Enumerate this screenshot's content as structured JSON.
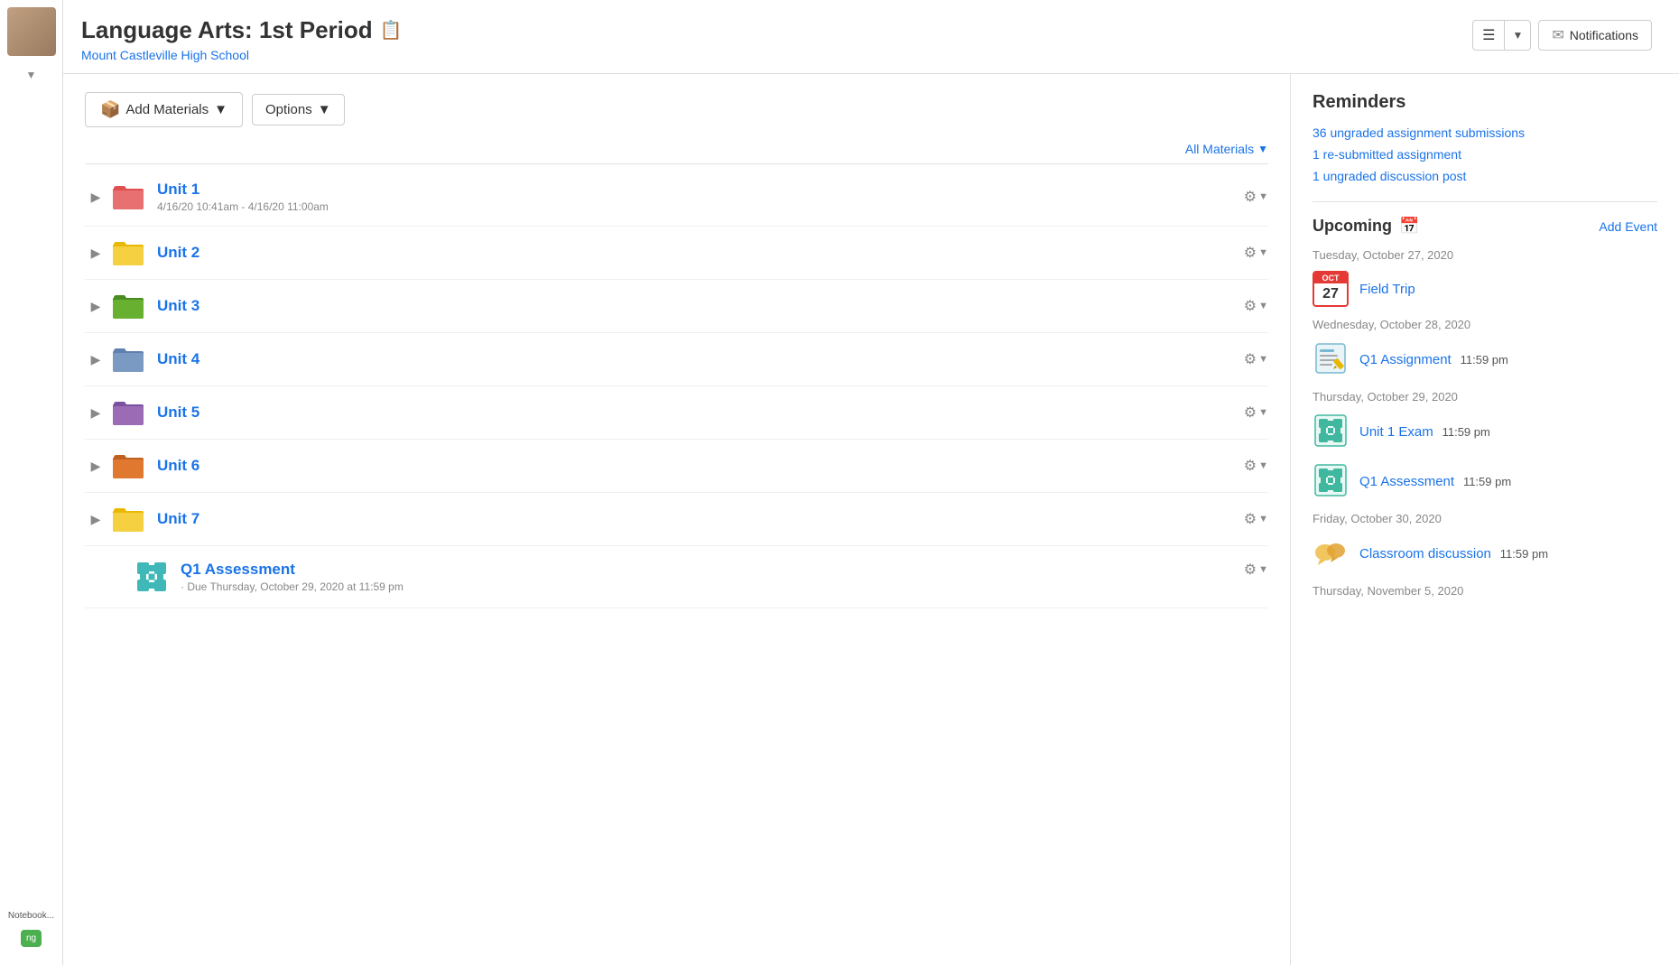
{
  "header": {
    "title": "Language Arts: 1st Period",
    "title_icon": "📋",
    "subtitle": "Mount Castleville High School",
    "notifications_label": "Notifications"
  },
  "toolbar": {
    "add_materials_label": "Add Materials",
    "options_label": "Options"
  },
  "filter": {
    "label": "All Materials"
  },
  "units": [
    {
      "id": 1,
      "name": "Unit 1",
      "color": "red",
      "date": "4/16/20 10:41am - 4/16/20 11:00am"
    },
    {
      "id": 2,
      "name": "Unit 2",
      "color": "yellow",
      "date": ""
    },
    {
      "id": 3,
      "name": "Unit 3",
      "color": "green",
      "date": ""
    },
    {
      "id": 4,
      "name": "Unit 4",
      "color": "blue",
      "date": ""
    },
    {
      "id": 5,
      "name": "Unit 5",
      "color": "purple",
      "date": ""
    },
    {
      "id": 6,
      "name": "Unit 6",
      "color": "orange",
      "date": ""
    },
    {
      "id": 7,
      "name": "Unit 7",
      "color": "yellow",
      "date": ""
    }
  ],
  "assessment": {
    "name": "Q1 Assessment",
    "due": "· Due Thursday, October 29, 2020 at 11:59 pm"
  },
  "reminders": {
    "title": "Reminders",
    "items": [
      "36 ungraded assignment submissions",
      "1 re-submitted assignment",
      "1 ungraded discussion post"
    ]
  },
  "upcoming": {
    "title": "Upcoming",
    "add_event_label": "Add Event",
    "days": [
      {
        "date": "Tuesday, October 27, 2020",
        "events": [
          {
            "name": "Field Trip",
            "time": "",
            "type": "calendar",
            "cal_num": "27"
          }
        ]
      },
      {
        "date": "Wednesday, October 28, 2020",
        "events": [
          {
            "name": "Q1 Assignment",
            "time": "11:59 pm",
            "type": "assignment"
          }
        ]
      },
      {
        "date": "Thursday, October 29, 2020",
        "events": [
          {
            "name": "Unit 1 Exam",
            "time": "11:59 pm",
            "type": "exam"
          },
          {
            "name": "Q1 Assessment",
            "time": "11:59 pm",
            "type": "exam"
          }
        ]
      },
      {
        "date": "Friday, October 30, 2020",
        "events": [
          {
            "name": "Classroom discussion",
            "time": "11:59 pm",
            "type": "discussion"
          }
        ]
      },
      {
        "date": "Thursday, November 5, 2020",
        "events": []
      }
    ]
  }
}
